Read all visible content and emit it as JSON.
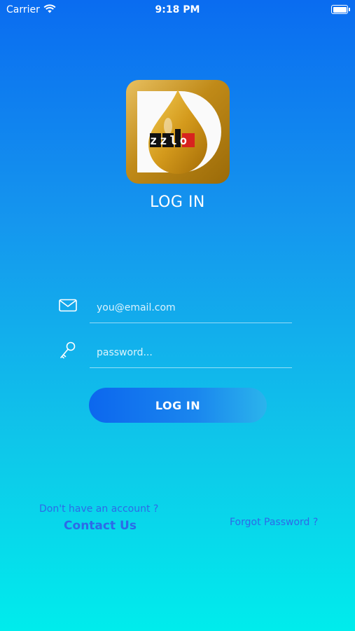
{
  "status_bar": {
    "carrier": "Carrier",
    "time": "9:18 PM"
  },
  "logo": {
    "text": "zzlo",
    "icon": "oil-drop-logo"
  },
  "page_title": "LOG IN",
  "email": {
    "placeholder": "you@email.com",
    "value": "",
    "icon": "mail-icon"
  },
  "password": {
    "placeholder": "password...",
    "value": "",
    "icon": "key-icon"
  },
  "login_button": "LOG IN",
  "footer": {
    "no_account": "Don't have an account ?",
    "contact": "Contact Us",
    "forgot": "Forgot Password ?"
  },
  "colors": {
    "gradient_top": "#0a6cf0",
    "gradient_bottom": "#00ecec",
    "link": "#2d6ae8"
  }
}
